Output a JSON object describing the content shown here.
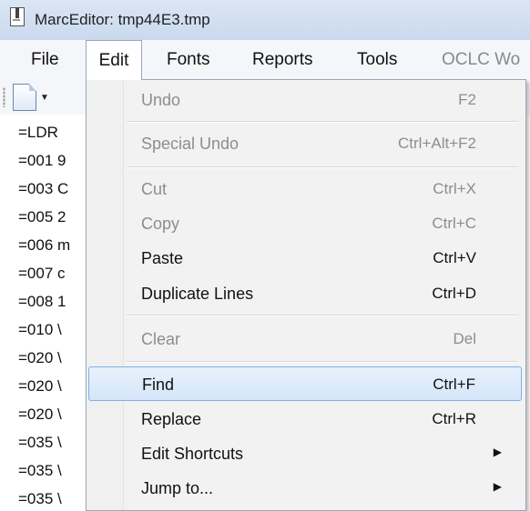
{
  "window": {
    "title": "MarcEditor: tmp44E3.tmp"
  },
  "menubar": {
    "items": [
      {
        "label": "File"
      },
      {
        "label": "Edit"
      },
      {
        "label": "Fonts"
      },
      {
        "label": "Reports"
      },
      {
        "label": "Tools"
      },
      {
        "label": "OCLC Wo"
      }
    ]
  },
  "toolbar": {
    "icons": [
      "new-document-icon",
      "dropdown-arrow-icon"
    ]
  },
  "editor": {
    "lines": [
      "=LDR",
      "=001 9",
      "=003 C",
      "=005 2",
      "=006 m",
      "=007 c",
      "=008 1",
      "=010 \\",
      "=020 \\",
      "=020 \\",
      "=020 \\",
      "=035 \\",
      "=035 \\",
      "=035 \\"
    ]
  },
  "edit_menu": {
    "items": [
      {
        "label": "Undo",
        "shortcut": "F2",
        "enabled": false
      },
      {
        "label": "Special Undo",
        "shortcut": "Ctrl+Alt+F2",
        "enabled": false
      },
      {
        "label": "Cut",
        "shortcut": "Ctrl+X",
        "enabled": false
      },
      {
        "label": "Copy",
        "shortcut": "Ctrl+C",
        "enabled": false
      },
      {
        "label": "Paste",
        "shortcut": "Ctrl+V",
        "enabled": true
      },
      {
        "label": "Duplicate Lines",
        "shortcut": "Ctrl+D",
        "enabled": true
      },
      {
        "label": "Clear",
        "shortcut": "Del",
        "enabled": false
      },
      {
        "label": "Find",
        "shortcut": "Ctrl+F",
        "enabled": true,
        "highlighted": true
      },
      {
        "label": "Replace",
        "shortcut": "Ctrl+R",
        "enabled": true
      },
      {
        "label": "Edit Shortcuts",
        "shortcut": "",
        "enabled": true,
        "submenu": true
      },
      {
        "label": "Jump to...",
        "shortcut": "",
        "enabled": true,
        "submenu": true
      }
    ]
  },
  "colors": {
    "highlight_border": "#7fb0e6",
    "titlebar": "#c9d9ee",
    "menu_bg": "#f2f2f2"
  }
}
